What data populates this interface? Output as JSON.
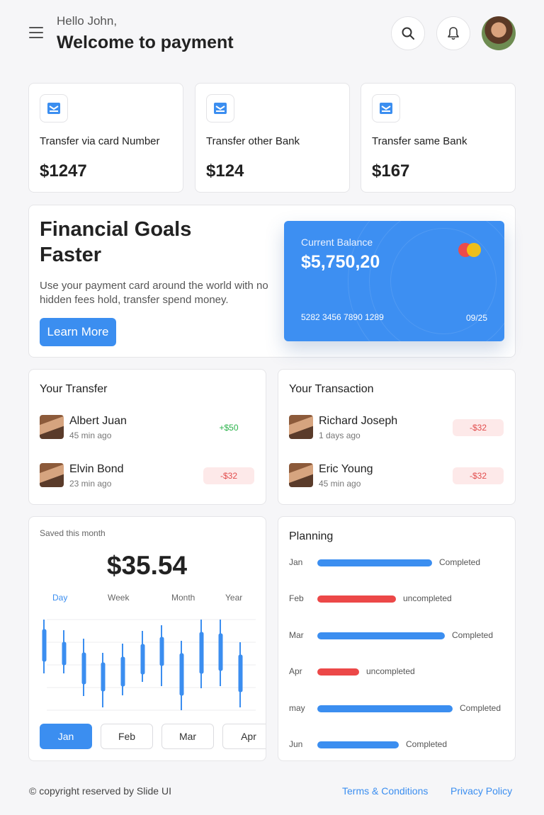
{
  "header": {
    "greeting": "Hello John,",
    "title": "Welcome to payment",
    "icons": [
      "menu-icon",
      "search-icon",
      "bell-icon"
    ]
  },
  "transfers_summary": [
    {
      "label": "Transfer via card Number",
      "amount": "$1247"
    },
    {
      "label": "Transfer other Bank",
      "amount": "$124"
    },
    {
      "label": "Transfer same Bank",
      "amount": "$167"
    }
  ],
  "promo": {
    "title_line1": "Financial Goals",
    "title_line2": "Faster",
    "text": "Use your payment card around the world with no hidden fees hold, transfer spend money.",
    "button": "Learn More"
  },
  "balance_card": {
    "label": "Current Balance",
    "amount": "$5,750,20",
    "number": "5282 3456 7890 1289",
    "expiry": "09/25",
    "color": "#3d8ff2"
  },
  "your_transfer": {
    "title": "Your Transfer",
    "items": [
      {
        "name": "Albert Juan",
        "time": "45 min ago",
        "amount": "+$50",
        "type": "positive"
      },
      {
        "name": "Elvin Bond",
        "time": "23 min ago",
        "amount": "-$32",
        "type": "negative"
      }
    ]
  },
  "your_transaction": {
    "title": "Your Transaction",
    "items": [
      {
        "name": "Richard Joseph",
        "time": "1 days ago",
        "amount": "-$32",
        "type": "negative"
      },
      {
        "name": "Eric Young",
        "time": "45 min ago",
        "amount": "-$32",
        "type": "negative"
      }
    ]
  },
  "saved": {
    "label": "Saved this month",
    "amount": "$35.54",
    "periods": [
      "Day",
      "Week",
      "Month",
      "Year"
    ],
    "active_period": "Day",
    "months": [
      "Jan",
      "Feb",
      "Mar",
      "Apr"
    ],
    "active_month": "Jan"
  },
  "planning": {
    "title": "Planning",
    "rows": [
      {
        "month": "Jan",
        "status": "Completed",
        "progress": 0.85,
        "color": "#3b8ef0"
      },
      {
        "month": "Feb",
        "status": "uncompleted",
        "progress": 0.58,
        "color": "#ec4848"
      },
      {
        "month": "Mar",
        "status": "Completed",
        "progress": 0.94,
        "color": "#3b8ef0"
      },
      {
        "month": "Apr",
        "status": "uncompleted",
        "progress": 0.31,
        "color": "#ec4848"
      },
      {
        "month": "may",
        "status": "Completed",
        "progress": 1.0,
        "color": "#3b8ef0"
      },
      {
        "month": "Jun",
        "status": "Completed",
        "progress": 0.6,
        "color": "#3b8ef0"
      }
    ]
  },
  "footer": {
    "copyright": "© copyright reserved by Slide UI",
    "terms": "Terms & Conditions",
    "privacy": "Privacy Policy"
  }
}
